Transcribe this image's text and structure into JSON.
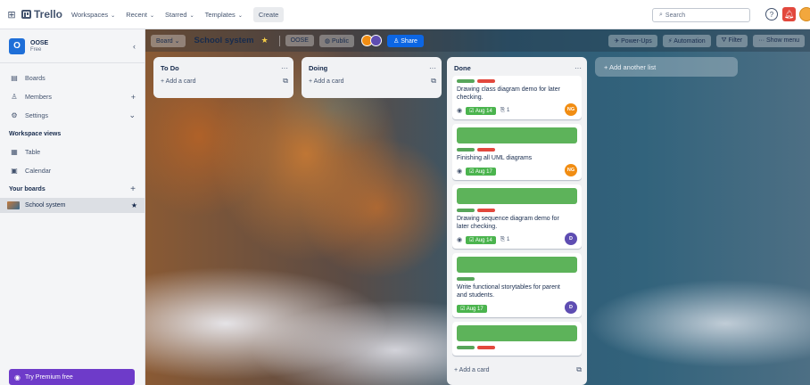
{
  "topbar": {
    "app_name": "Trello",
    "menus": [
      "Workspaces",
      "Recent",
      "Starred",
      "Templates"
    ],
    "create_label": "Create",
    "search_placeholder": "Search",
    "help_icon": "help-icon",
    "notifications_icon": "bell-icon"
  },
  "sidebar": {
    "workspace": {
      "badge": "O",
      "name": "OOSE",
      "plan": "Free"
    },
    "items": [
      {
        "label": "Boards",
        "icon": "boards-icon"
      },
      {
        "label": "Members",
        "icon": "members-icon",
        "trail": "+"
      },
      {
        "label": "Settings",
        "icon": "settings-icon",
        "trail": "⌄"
      }
    ],
    "views_title": "Workspace views",
    "views": [
      {
        "label": "Table",
        "icon": "table-icon"
      },
      {
        "label": "Calendar",
        "icon": "calendar-icon"
      }
    ],
    "boards_title": "Your boards",
    "boards": [
      {
        "label": "School system"
      }
    ],
    "premium_label": "Try Premium free"
  },
  "board_header": {
    "view_switcher": "Board",
    "title": "School system",
    "workspace_button": "OOSE",
    "visibility_button": "Public",
    "share_label": "Share",
    "power_ups": "Power-Ups",
    "automation": "Automation",
    "filter": "Filter",
    "show_menu": "Show menu",
    "colors": {
      "share_bg": "#0c66e4",
      "star": "#f5cd47"
    }
  },
  "lists": [
    {
      "title": "To Do",
      "add_card": "+ Add a card",
      "cards": []
    },
    {
      "title": "Doing",
      "add_card": "+ Add a card",
      "cards": []
    },
    {
      "title": "Done",
      "add_card": "+ Add a card",
      "cards": [
        {
          "title": "Drawing class diagram demo for later checking.",
          "date": "Aug 14",
          "attachments": "1",
          "member": "NG",
          "member_color": "#f18d13"
        },
        {
          "title": "Finishing all UML diagrams",
          "date": "Aug 17",
          "attachments": "",
          "member": "NG",
          "member_color": "#f18d13"
        },
        {
          "title": "Drawing sequence diagram demo for later checking.",
          "date": "Aug 14",
          "attachments": "1",
          "member": "D",
          "member_color": "#5e4db2"
        },
        {
          "title": "Write functional storytables for parent and students.",
          "date": "Aug 17",
          "attachments": "",
          "member": "D",
          "member_color": "#5e4db2"
        }
      ]
    }
  ],
  "add_list_label": "+ Add another list",
  "colors": {
    "card_cover": "#5db35a",
    "label_green": "#57a55a",
    "label_red": "#e2483d",
    "date_badge": "#4bb44e"
  }
}
